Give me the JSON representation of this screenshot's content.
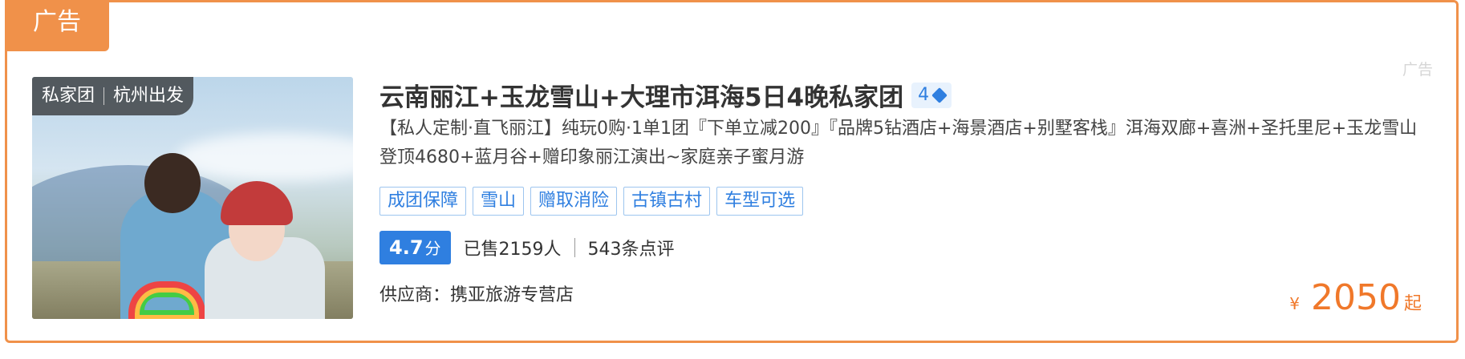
{
  "ad_tab": "广告",
  "ad_corner": "广告",
  "thumbnail": {
    "tag_type": "私家团",
    "tag_departure": "杭州出发"
  },
  "product": {
    "title": "云南丽江+玉龙雪山+大理市洱海5日4晚私家团",
    "level": "4",
    "level_icon": "diamond-icon",
    "description": "【私人定制·直飞丽江】纯玩0购·1单1团『下单立减200』『品牌5钻酒店+海景酒店+别墅客栈』洱海双廊+喜洲+圣托里尼+玉龙雪山登顶4680+蓝月谷+赠印象丽江演出~家庭亲子蜜月游",
    "tags": [
      "成团保障",
      "雪山",
      "赠取消险",
      "古镇古村",
      "车型可选"
    ],
    "score": "4.7",
    "score_unit": "分",
    "sold": "已售2159人",
    "reviews": "543条点评",
    "supplier": "供应商：携亚旅游专营店",
    "price_currency": "¥",
    "price": "2050",
    "price_suffix": "起"
  },
  "colors": {
    "accent_orange": "#f0914a",
    "link_blue": "#2f7fe0",
    "price_orange": "#f0782a"
  }
}
